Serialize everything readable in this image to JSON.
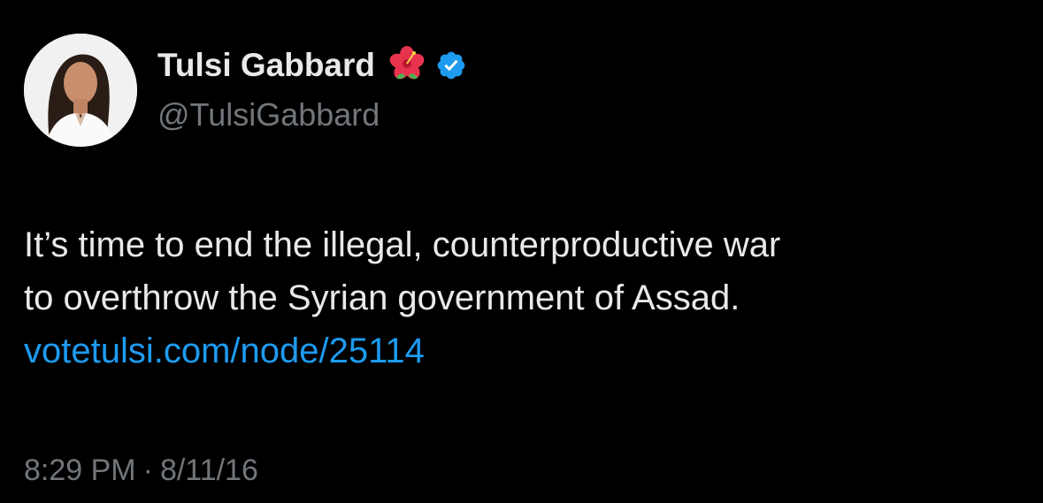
{
  "author": {
    "display_name": "Tulsi Gabbard",
    "handle": "@TulsiGabbard",
    "flower_emoji": "hibiscus-icon",
    "verified_icon": "verified-badge-icon",
    "verified_color": "#1d9bf0"
  },
  "tweet": {
    "line1": "It’s time to end the illegal, counterproductive war",
    "line2": "to overthrow the Syrian government of Assad.",
    "link": "votetulsi.com/node/25114",
    "link_color": "#1d9bf0"
  },
  "meta": {
    "time": "8:29 PM",
    "separator": "·",
    "date": "8/11/16"
  },
  "colors": {
    "background": "#000000",
    "primary_text": "#e7e9ea",
    "secondary_text": "#71767b"
  }
}
